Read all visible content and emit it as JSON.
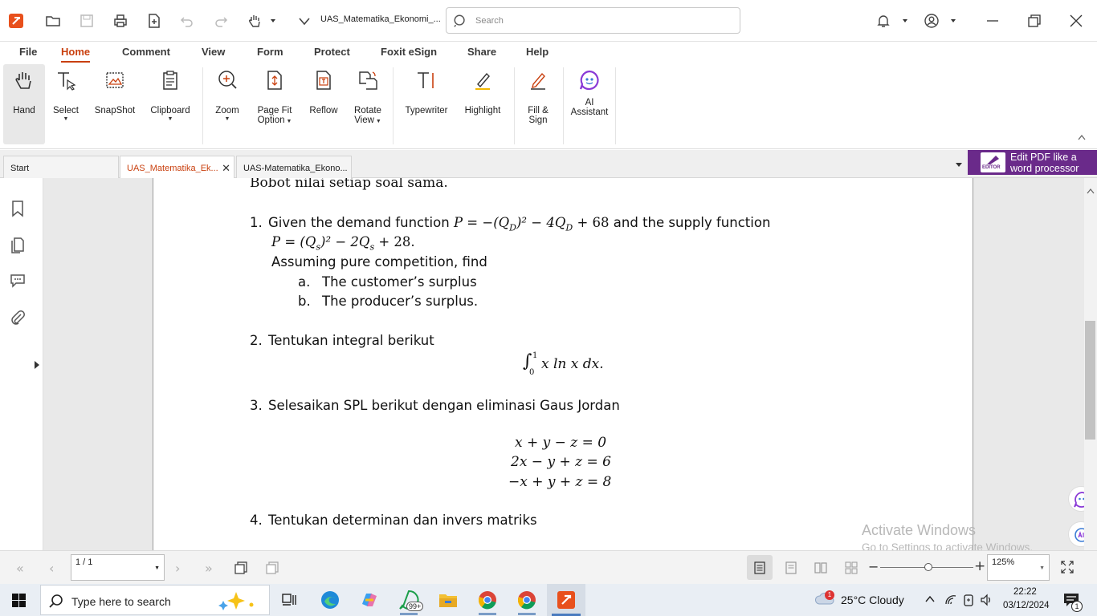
{
  "titlebar": {
    "doc_title": "UAS_Matematika_Ekonomi_...",
    "search_placeholder": "Search"
  },
  "menu": {
    "items": [
      "File",
      "Home",
      "Comment",
      "View",
      "Form",
      "Protect",
      "Foxit eSign",
      "Share",
      "Help"
    ],
    "active": "Home"
  },
  "ribbon": {
    "hand": "Hand",
    "select": "Select",
    "snapshot": "SnapShot",
    "clipboard": "Clipboard",
    "zoom": "Zoom",
    "pagefit_1": "Page Fit",
    "pagefit_2": "Option",
    "reflow": "Reflow",
    "rotate_1": "Rotate",
    "rotate_2": "View",
    "typewriter": "Typewriter",
    "highlight": "Highlight",
    "fillsign_1": "Fill &",
    "fillsign_2": "Sign",
    "ai_1": "AI",
    "ai_2": "Assistant"
  },
  "tabs": {
    "start": "Start",
    "tab1": "UAS_Matematika_Ek...",
    "tab2": "UAS-Matematika_Ekono..."
  },
  "promo": {
    "line1": "Edit PDF like a",
    "line2": "word processor",
    "badge": "EDITOR"
  },
  "document": {
    "top_line": "Bobot nilai setiap soal sama.",
    "q1_num": "1.",
    "q1_text_a": "Given the demand function",
    "q1_eq1": "P = −(Q",
    "q1_eq1_sub": "D",
    "q1_eq1_rest": ")² − 4Q",
    "q1_eq1_sub2": "D",
    "q1_eq1_end": " + 68",
    "q1_text_b": "and the supply function",
    "q1_eq2": "P = (Q",
    "q1_eq2_sub": "s",
    "q1_eq2_rest": ")² − 2Q",
    "q1_eq2_sub2": "s",
    "q1_eq2_end": " + 28.",
    "q1_assume": "Assuming pure competition, find",
    "q1_a_label": "a.",
    "q1_a": "The customer’s surplus",
    "q1_b_label": "b.",
    "q1_b": "The producer’s surplus.",
    "q2_num": "2.",
    "q2_text": "Tentukan integral berikut",
    "q2_int_upper": "1",
    "q2_int_lower": "0",
    "q2_integrand": "x ln x dx.",
    "q3_num": "3.",
    "q3_text": "Selesaikan SPL berikut dengan eliminasi Gaus Jordan",
    "q3_eq1": "x + y − z = 0",
    "q3_eq2": "2x − y + z = 6",
    "q3_eq3": "−x + y + z = 8",
    "q4_num": "4.",
    "q4_text": "Tentukan determinan dan invers matriks"
  },
  "watermark": {
    "line1": "Activate Windows",
    "line2": "Go to Settings to activate Windows."
  },
  "status": {
    "page": "1 / 1",
    "zoom": "125%"
  },
  "taskbar": {
    "search_placeholder": "Type here to search",
    "whatsapp_badge": "99+",
    "weather": "25°C  Cloudy",
    "weather_badge": "1",
    "time": "22:22",
    "date": "03/12/2024",
    "notif_count": "1"
  },
  "colors": {
    "accent": "#c9400f",
    "promo": "#6a2a8a",
    "taskbar": "#e9eef4"
  }
}
